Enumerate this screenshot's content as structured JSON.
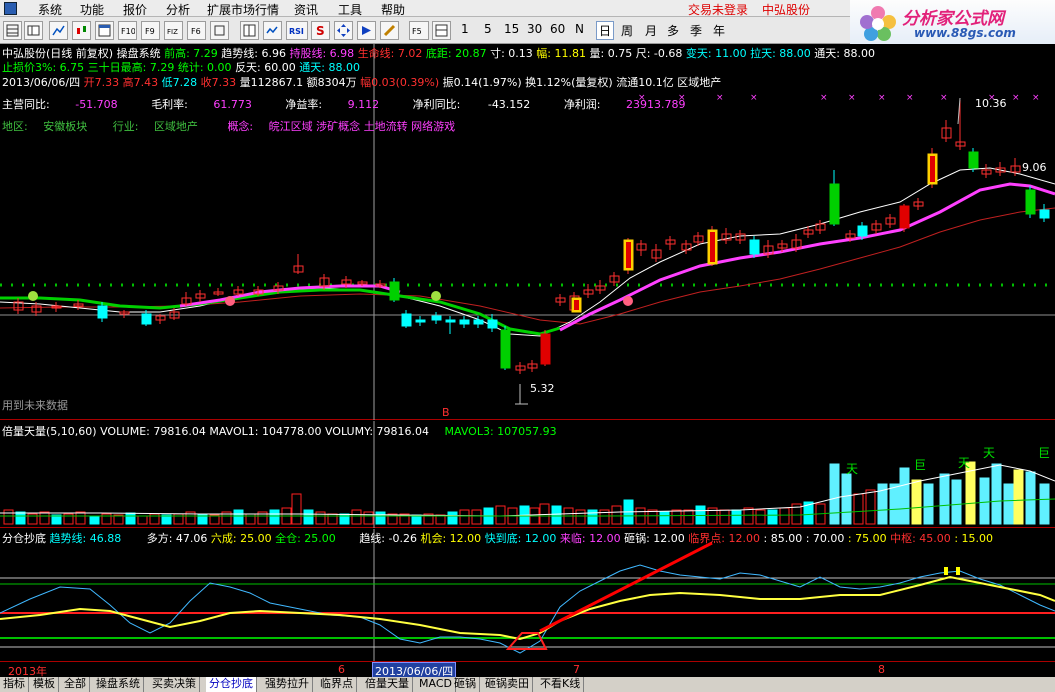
{
  "menu": {
    "items": [
      "系统",
      "功能",
      "报价",
      "分析",
      "扩展市场行情",
      "资讯",
      "工具",
      "帮助"
    ],
    "login_status": "交易未登录",
    "stock_name": "中弘股份"
  },
  "toolbar": {
    "icons": [
      "grid-icon",
      "table-icon",
      "line-chart-icon",
      "kline-icon",
      "window-icon",
      "f10-icon",
      "f9-icon",
      "fiz-icon",
      "f6-icon",
      "vol-chart-icon",
      "rsi-icon",
      "s-icon",
      "move-icon",
      "forward-icon",
      "pen-icon"
    ],
    "rsi_label": "RSI",
    "f10_label": "F10",
    "f9_label": "F9",
    "fiz_label": "FIZ",
    "f6_label": "F6",
    "f5_label": "F5",
    "periods": [
      "1",
      "5",
      "15",
      "30",
      "60",
      "N",
      "日",
      "周",
      "月",
      "多",
      "季",
      "年"
    ],
    "selected_period": "日"
  },
  "brand": {
    "title": "分析家公式网",
    "url": "www.88gs.com"
  },
  "main": {
    "line1": [
      {
        "t": "中弘股份(日线 前复权) 操盘系统",
        "c": "w"
      },
      {
        "t": "前高: 7.29",
        "c": "g"
      },
      {
        "t": "趋势线: 6.96",
        "c": "w"
      },
      {
        "t": "持股线: 6.98",
        "c": "m"
      },
      {
        "t": "生命线: 7.02",
        "c": "r"
      },
      {
        "t": "底距: 20.87",
        "c": "g"
      },
      {
        "t": "寸: 0.13",
        "c": "w"
      },
      {
        "t": "幅: 11.81",
        "c": "y"
      },
      {
        "t": "量: 0.75",
        "c": "w"
      },
      {
        "t": "尺: -0.68",
        "c": "w"
      },
      {
        "t": "变天: 11.00",
        "c": "c"
      },
      {
        "t": "拉天: 88.00",
        "c": "c"
      },
      {
        "t": "通天: 88.00",
        "c": "w"
      }
    ],
    "line2": [
      {
        "t": "止损价3%: 6.75",
        "c": "g"
      },
      {
        "t": "三十日最高: 7.29",
        "c": "g"
      },
      {
        "t": "统计: 0.00",
        "c": "g"
      },
      {
        "t": "反天: 60.00",
        "c": "w"
      },
      {
        "t": "通天: 88.00",
        "c": "c"
      }
    ],
    "quote": [
      {
        "t": "2013/06/06/四",
        "c": "w"
      },
      {
        "t": "开7.33",
        "c": "r"
      },
      {
        "t": "高7.43",
        "c": "r"
      },
      {
        "t": "低7.28",
        "c": "c"
      },
      {
        "t": "收7.33",
        "c": "r"
      },
      {
        "t": "量112867.1",
        "c": "w"
      },
      {
        "t": "额8304万",
        "c": "w"
      },
      {
        "t": "幅0.03(0.39%)",
        "c": "r"
      },
      {
        "t": "振0.14(1.97%)",
        "c": "w"
      },
      {
        "t": "换1.12%(量复权)",
        "c": "w"
      },
      {
        "t": "流通10.1亿",
        "c": "w"
      },
      {
        "t": "区域地产",
        "c": "w"
      }
    ],
    "fin": [
      {
        "label": "主营同比:",
        "value": "-51.708"
      },
      {
        "label": "毛利率:",
        "value": "61.773"
      },
      {
        "label": "净益率:",
        "value": "9.112"
      },
      {
        "label": "净利同比:",
        "value": "-43.152"
      },
      {
        "label": "净利润:",
        "value": "23913.789"
      }
    ],
    "region_label": "地区:",
    "region": "安徽板块",
    "industry_label": "行业:",
    "industry": "区域地产",
    "concept_label": "概念:",
    "concept": "皖江区域 涉矿概念 土地流转 网络游戏",
    "high_label": "10.36",
    "low_label": "5.32",
    "mid_label": "9.06",
    "ref_note": "用到未来数据",
    "marker_mid": "B"
  },
  "volume": {
    "title": "倍量天量(5,10,60)",
    "values": [
      {
        "t": "VOLUME: 79816.04",
        "c": "w"
      },
      {
        "t": "MAVOL1: 104778.00",
        "c": "w"
      },
      {
        "t": "VOLUMY: 79816.04",
        "c": "w"
      },
      {
        "t": "MAVOL3: 107057.93",
        "c": "g"
      }
    ],
    "tags": [
      "天",
      "巨",
      "天",
      "天",
      "巨"
    ]
  },
  "indicator": {
    "title": "分仓抄底",
    "values": [
      {
        "t": "趋势线: 46.88",
        "c": "c"
      },
      {
        "t": "多方: 47.06",
        "c": "w"
      },
      {
        "t": "六成: 25.00",
        "c": "y"
      },
      {
        "t": "全仓: 25.00",
        "c": "g"
      },
      {
        "t": "趋线: -0.26",
        "c": "w"
      },
      {
        "t": "机会: 12.00",
        "c": "y"
      },
      {
        "t": "快到底: 12.00",
        "c": "c"
      },
      {
        "t": "来临: 12.00",
        "c": "m"
      },
      {
        "t": "砸锅: 12.00",
        "c": "w"
      },
      {
        "t": "临界点: 12.00",
        "c": "r"
      },
      {
        "t": ": 85.00",
        "c": "w"
      },
      {
        "t": ": 70.00",
        "c": "w"
      },
      {
        "t": ": 75.00",
        "c": "y"
      },
      {
        "t": "中枢: 45.00",
        "c": "r"
      },
      {
        "t": ": 15.00",
        "c": "y"
      }
    ]
  },
  "timeaxis": {
    "labels": [
      "2013年",
      "6",
      "7",
      "8"
    ],
    "selected": "2013/06/06/四"
  },
  "tabs": [
    "指标",
    "模板",
    "全部",
    "操盘系统",
    "买卖决策",
    "分仓抄底",
    "强势拉升",
    "临界点",
    "倍量天量",
    "MACD",
    "砸锅",
    "砸锅卖田",
    "不看K线"
  ],
  "active_tab": "分仓抄底",
  "colors": {
    "up": "#ff3030",
    "down": "#00ffff",
    "buy_green": "#00e000",
    "purple": "#ff40ff",
    "yellow": "#ffff00"
  }
}
